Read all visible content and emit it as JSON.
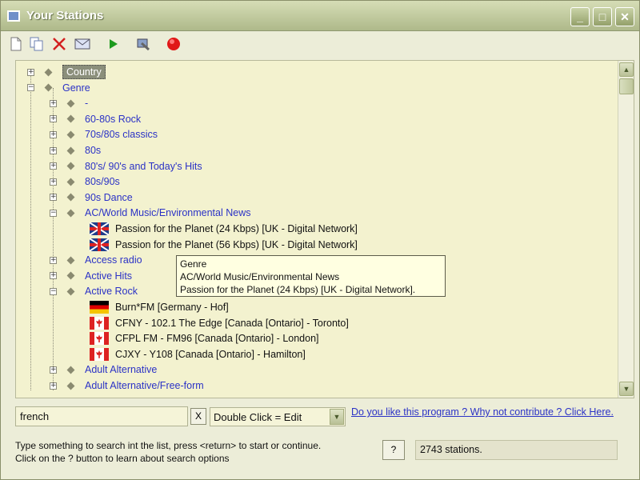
{
  "window": {
    "title": "Your Stations",
    "minimize_glyph": "_",
    "maximize_glyph": "□",
    "close_glyph": "✕"
  },
  "toolbar": {
    "buttons": [
      {
        "name": "new-icon"
      },
      {
        "name": "copy-icon"
      },
      {
        "name": "delete-icon"
      },
      {
        "name": "email-icon"
      },
      {
        "name": "play-icon"
      },
      {
        "name": "tools-icon"
      },
      {
        "name": "record-icon"
      }
    ]
  },
  "colors": {
    "link": "#2b32c6",
    "tree_background": "#f3f2cf",
    "window_background": "#ecedd8",
    "delete": "#d32020",
    "play": "#1d9a1d",
    "record": "#e01818"
  },
  "tree": {
    "rows": [
      {
        "level": 0,
        "kind": "node",
        "expander": "+",
        "label": "Country",
        "selected": true
      },
      {
        "level": 0,
        "kind": "node",
        "expander": "−",
        "label": "Genre"
      },
      {
        "level": 1,
        "kind": "node",
        "expander": "+",
        "label": "-"
      },
      {
        "level": 1,
        "kind": "node",
        "expander": "+",
        "label": "60-80s Rock"
      },
      {
        "level": 1,
        "kind": "node",
        "expander": "+",
        "label": "70s/80s classics"
      },
      {
        "level": 1,
        "kind": "node",
        "expander": "+",
        "label": "80s"
      },
      {
        "level": 1,
        "kind": "node",
        "expander": "+",
        "label": "80's/ 90's and Today's Hits"
      },
      {
        "level": 1,
        "kind": "node",
        "expander": "+",
        "label": "80s/90s"
      },
      {
        "level": 1,
        "kind": "node",
        "expander": "+",
        "label": "90s Dance"
      },
      {
        "level": 1,
        "kind": "node",
        "expander": "−",
        "label": "AC/World Music/Environmental News"
      },
      {
        "level": 2,
        "kind": "station",
        "flag": "uk",
        "label": "Passion for the Planet (24 Kbps)  [UK - Digital Network]"
      },
      {
        "level": 2,
        "kind": "station",
        "flag": "uk",
        "label": "Passion for the Planet (56 Kbps)  [UK - Digital Network]"
      },
      {
        "level": 1,
        "kind": "node",
        "expander": "+",
        "label": "Access radio"
      },
      {
        "level": 1,
        "kind": "node",
        "expander": "+",
        "label": "Active Hits"
      },
      {
        "level": 1,
        "kind": "node",
        "expander": "−",
        "label": "Active Rock"
      },
      {
        "level": 2,
        "kind": "station",
        "flag": "de",
        "label": "Burn*FM  [Germany - Hof]"
      },
      {
        "level": 2,
        "kind": "station",
        "flag": "ca",
        "label": "CFNY - 102.1 The Edge  [Canada [Ontario] - Toronto]"
      },
      {
        "level": 2,
        "kind": "station",
        "flag": "ca",
        "label": "CFPL FM - FM96  [Canada [Ontario] - London]"
      },
      {
        "level": 2,
        "kind": "station",
        "flag": "ca",
        "label": "CJXY - Y108  [Canada [Ontario] - Hamilton]"
      },
      {
        "level": 1,
        "kind": "node",
        "expander": "+",
        "label": "Adult Alternative"
      },
      {
        "level": 1,
        "kind": "node",
        "expander": "+",
        "label": "Adult Alternative/Free-form"
      }
    ],
    "scroll_up_glyph": "▲",
    "scroll_down_glyph": "▼"
  },
  "tooltip": {
    "lines": [
      "Genre",
      "AC/World Music/Environmental News",
      "Passion for the Planet (24 Kbps)  [UK - Digital Network]."
    ]
  },
  "search": {
    "value": "french",
    "clear_label": "X"
  },
  "mode_select": {
    "selected": "Double Click = Edit",
    "arrow_glyph": "▼"
  },
  "contribute_link": "Do you like this program ? Why not contribute ? Click Here.",
  "help": {
    "line1": "Type something to search int the list, press <return> to start or continue.",
    "line2": "Click on the ? button to learn about search options",
    "button_label": "?"
  },
  "status": {
    "text": "2743 stations."
  }
}
